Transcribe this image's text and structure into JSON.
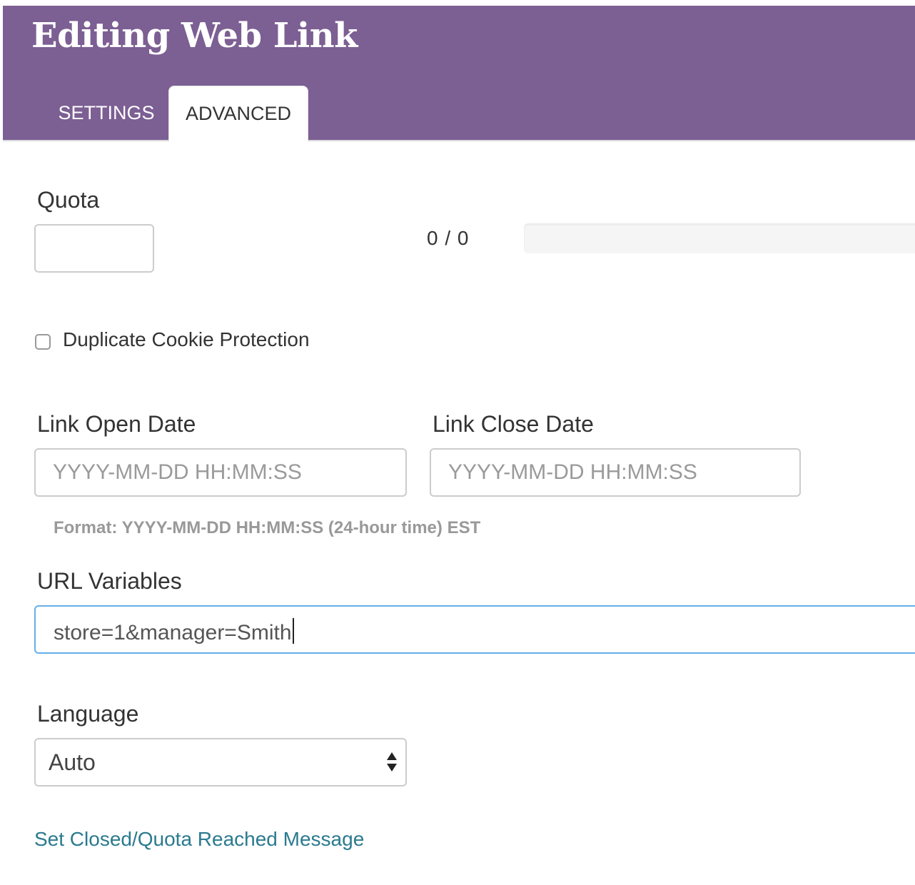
{
  "header": {
    "title": "Editing Web Link",
    "tabs": [
      {
        "label": "SETTINGS",
        "active": false
      },
      {
        "label": "ADVANCED",
        "active": true
      }
    ]
  },
  "colors": {
    "header_bg": "#7c5f93",
    "focus_border": "#66afe9",
    "link": "#2a7a8f"
  },
  "quota": {
    "label": "Quota",
    "value": "",
    "count_text": "0 / 0",
    "progress_fraction": 0
  },
  "duplicate_cookie": {
    "label": "Duplicate Cookie Protection",
    "checked": false
  },
  "link_open_date": {
    "label": "Link Open Date",
    "placeholder": "YYYY-MM-DD HH:MM:SS",
    "value": ""
  },
  "link_close_date": {
    "label": "Link Close Date",
    "placeholder": "YYYY-MM-DD HH:MM:SS",
    "value": ""
  },
  "date_help": "Format: YYYY-MM-DD HH:MM:SS (24-hour time) EST",
  "url_variables": {
    "label": "URL Variables",
    "value": "store=1&manager=Smith"
  },
  "language": {
    "label": "Language",
    "selected": "Auto"
  },
  "closed_message_link": "Set Closed/Quota Reached Message"
}
